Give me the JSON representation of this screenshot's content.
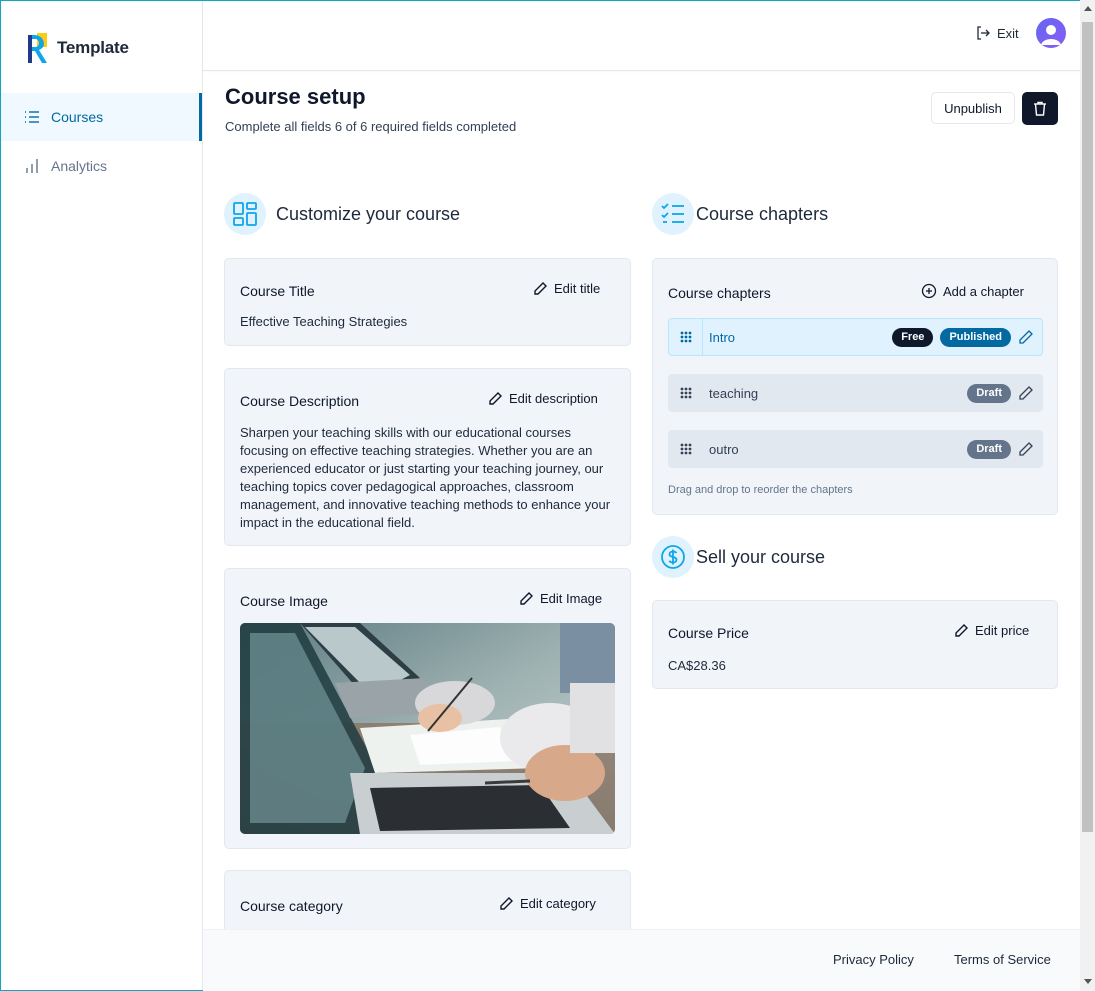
{
  "brand": {
    "name": "Template"
  },
  "sidebar": {
    "items": [
      {
        "label": "Courses",
        "icon": "list-icon",
        "active": true
      },
      {
        "label": "Analytics",
        "icon": "bar-chart-icon",
        "active": false
      }
    ]
  },
  "topbar": {
    "exit_label": "Exit"
  },
  "page": {
    "title": "Course setup",
    "subtitle": "Complete all fields 6 of 6 required fields completed",
    "unpublish_label": "Unpublish"
  },
  "customize": {
    "heading": "Customize your course",
    "title_card": {
      "label": "Course Title",
      "action": "Edit title",
      "value": "Effective Teaching Strategies"
    },
    "description_card": {
      "label": "Course Description",
      "action": "Edit description",
      "value": "Sharpen your teaching skills with our educational courses focusing on effective teaching strategies. Whether you are an experienced educator or just starting your teaching journey, our teaching topics cover pedagogical approaches, classroom management, and innovative teaching methods to enhance your impact in the educational field."
    },
    "image_card": {
      "label": "Course Image",
      "action": "Edit Image"
    },
    "category_card": {
      "label": "Course category",
      "action": "Edit category"
    }
  },
  "chapters": {
    "heading": "Course chapters",
    "card_label": "Course chapters",
    "add_label": "Add a chapter",
    "items": [
      {
        "name": "Intro",
        "free": "Free",
        "status": "Published"
      },
      {
        "name": "teaching",
        "status": "Draft"
      },
      {
        "name": "outro",
        "status": "Draft"
      }
    ],
    "hint": "Drag and drop to reorder the chapters"
  },
  "sell": {
    "heading": "Sell your course",
    "price_card": {
      "label": "Course Price",
      "action": "Edit price",
      "value": "CA$28.36"
    }
  },
  "footer": {
    "privacy": "Privacy Policy",
    "terms": "Terms of Service"
  },
  "colors": {
    "accent": "#0369a1",
    "accent_light": "#e0f2fe",
    "dark": "#0f172a",
    "card_bg": "#f1f5f9",
    "draft": "#64748b"
  }
}
